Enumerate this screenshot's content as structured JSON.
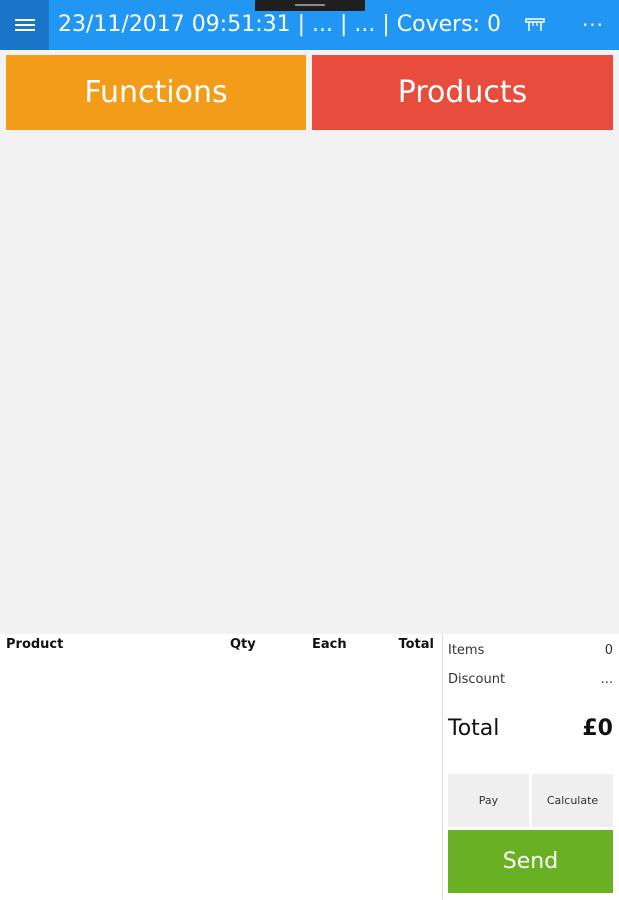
{
  "header": {
    "title": "23/11/2017 09:51:31 | ... | ... | Covers: 0",
    "menu_icon": "hamburger-menu-icon",
    "table_icon": "table-icon",
    "more_icon": "more-options-icon",
    "more_glyph": "···",
    "background_color": "#2196f3"
  },
  "main": {
    "functions_label": "Functions",
    "products_label": "Products",
    "functions_color": "#f39c19",
    "products_color": "#e84c3d"
  },
  "order": {
    "columns": [
      "Product",
      "Qty",
      "Each",
      "Total"
    ]
  },
  "summary": {
    "items_label": "Items",
    "items_value": "0",
    "discount_label": "Discount",
    "discount_value": "...",
    "total_label": "Total",
    "total_value": "£0",
    "pay_label": "Pay",
    "calculate_label": "Calculate",
    "send_label": "Send",
    "send_color": "#6ab023"
  }
}
